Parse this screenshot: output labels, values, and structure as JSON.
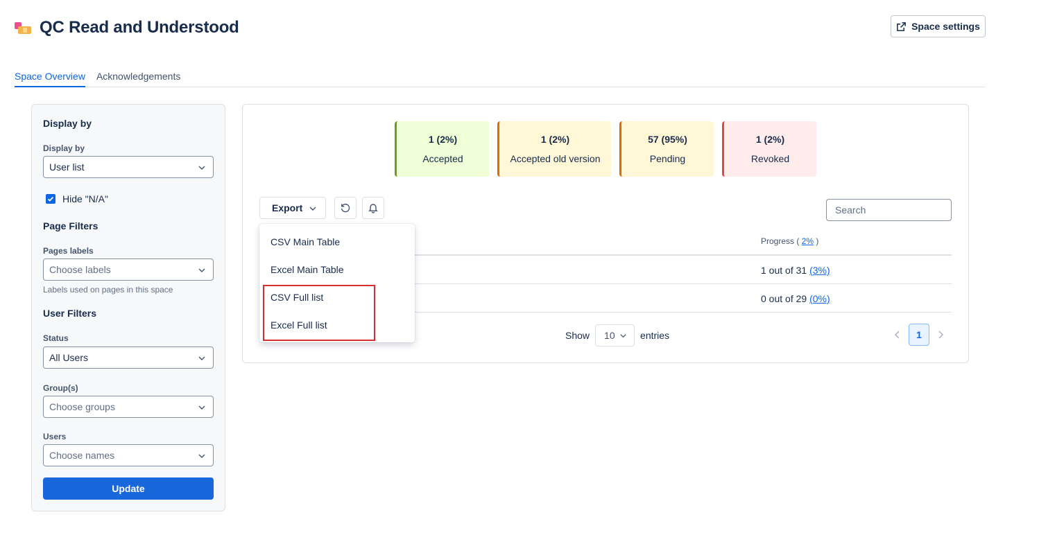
{
  "header": {
    "title": "QC Read and Understood",
    "settings_label": "Space settings"
  },
  "tabs": [
    {
      "label": "Space Overview",
      "active": true
    },
    {
      "label": "Acknowledgements",
      "active": false
    }
  ],
  "sidebar": {
    "display_heading": "Display by",
    "display_label": "Display by",
    "display_value": "User list",
    "hide_na_label": "Hide \"N/A\"",
    "hide_na_checked": true,
    "page_filters_heading": "Page Filters",
    "pages_labels_label": "Pages labels",
    "pages_labels_placeholder": "Choose labels",
    "pages_labels_help": "Labels used on pages in this space",
    "user_filters_heading": "User Filters",
    "status_label": "Status",
    "status_value": "All Users",
    "groups_label": "Group(s)",
    "groups_placeholder": "Choose groups",
    "users_label": "Users",
    "users_placeholder": "Choose names",
    "update_label": "Update"
  },
  "stats": [
    {
      "count": "1 (2%)",
      "label": "Accepted",
      "color": "#6a9a23"
    },
    {
      "count": "1 (2%)",
      "label": "Accepted old version",
      "color": "#e06c00"
    },
    {
      "count": "57 (95%)",
      "label": "Pending",
      "color": "#e06c00"
    },
    {
      "count": "1 (2%)",
      "label": "Revoked",
      "color": "#e2483d"
    }
  ],
  "toolbar": {
    "export_label": "Export",
    "search_placeholder": "Search"
  },
  "export_menu": [
    "CSV Main Table",
    "Excel Main Table",
    "CSV Full list",
    "Excel Full list"
  ],
  "table": {
    "progress_header": "Progress (",
    "progress_header_link": "2%",
    "progress_header_close": ")",
    "rows": [
      {
        "progress": "1 out of 31",
        "percent": "(3%)"
      },
      {
        "progress": "0 out of 29",
        "percent": "(0%)"
      }
    ]
  },
  "pagination": {
    "show_label": "Show",
    "page_size": "10",
    "entries_label": "entries",
    "current_page": "1"
  },
  "colors": {
    "accent": "#0c66e4",
    "update_button": "#1868db",
    "highlight": "#d32f2f"
  }
}
